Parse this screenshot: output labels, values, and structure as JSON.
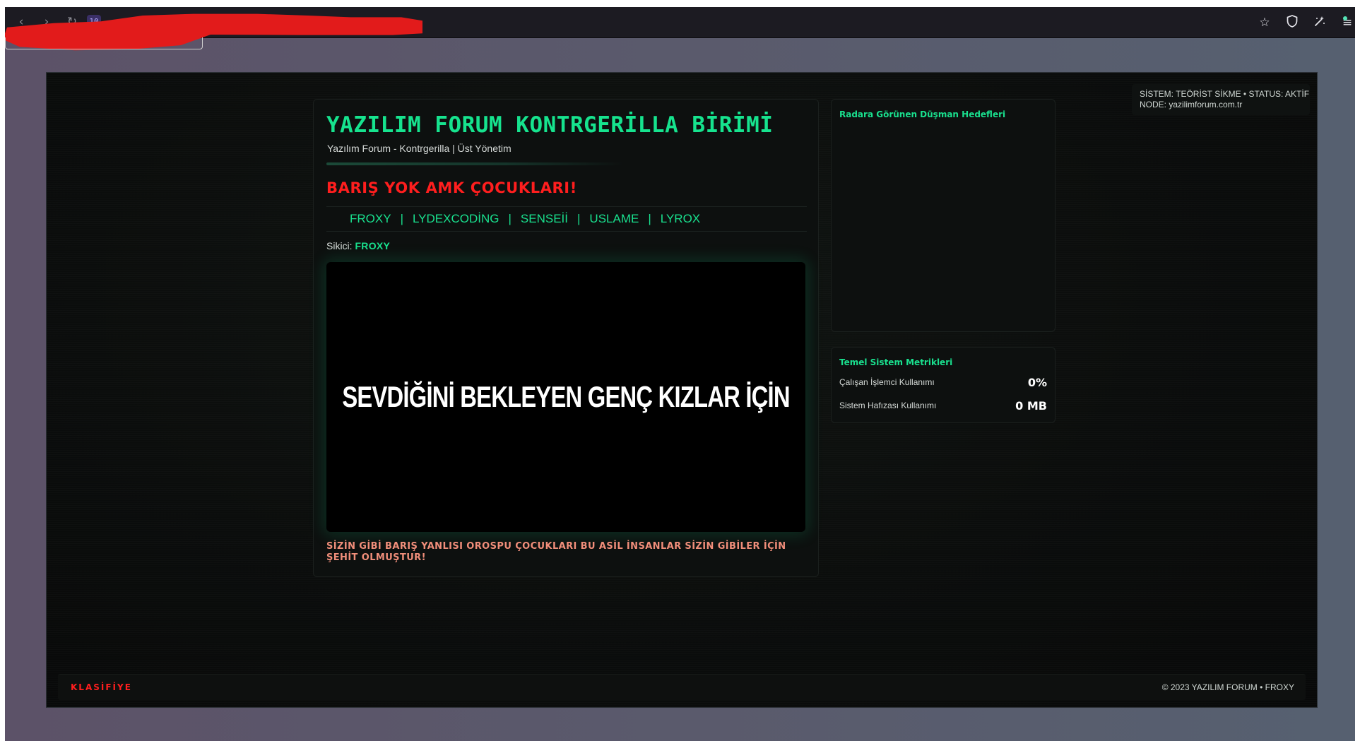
{
  "browser": {
    "nav": {
      "back": "‹",
      "forward": "›",
      "reload": "↻"
    },
    "url_chip": "10",
    "toolbar_icons": [
      "star-icon",
      "shield-icon",
      "extensions-icon",
      "menu-icon"
    ]
  },
  "status": {
    "line1": "SİSTEM: TEÖRİST SİKME • STATUS: AKTİF",
    "line2": "NODE: yazilimforum.com.tr"
  },
  "header": {
    "title": "YAZILIM FORUM KONTRGERİLLA BİRİMİ",
    "subtitle": "Yazılım Forum - Kontrgerilla | Üst Yönetim"
  },
  "headline": "BARIŞ YOK AMK ÇOCUKLARI!",
  "members": [
    "FROXY",
    "LYDEXCODİNG",
    "SENSEİİ",
    "USLAME",
    "LYROX"
  ],
  "member_separator": "|",
  "sikici": {
    "label": "Sikici:",
    "name": "FROXY"
  },
  "video": {
    "caption": "SEVDİĞİNİ BEKLEYEN GENÇ KIZLAR İÇİN"
  },
  "bottom_note": "SİZİN GİBİ BARIŞ YANLISI OROSPU ÇOCUKLARI BU ASİL İNSANLAR SİZİN GİBİLER İÇİN ŞEHİT OLMUŞTUR!",
  "radar": {
    "title": "Radara Görünen Düşman Hedefleri"
  },
  "metrics": {
    "title": "Temel Sistem Metrikleri",
    "items": [
      {
        "label": "Çalışan İşlemci Kullanımı",
        "value": "0%"
      },
      {
        "label": "Sistem Hafızası Kullanımı",
        "value": "0 MB"
      }
    ]
  },
  "footer": {
    "classified": "KLASİFİYE",
    "copyright": "© 2023 YAZILIM FORUM • FROXY"
  },
  "colors": {
    "accent": "#16e38e",
    "alert": "#ff1e1e",
    "note": "#f08e7a"
  }
}
